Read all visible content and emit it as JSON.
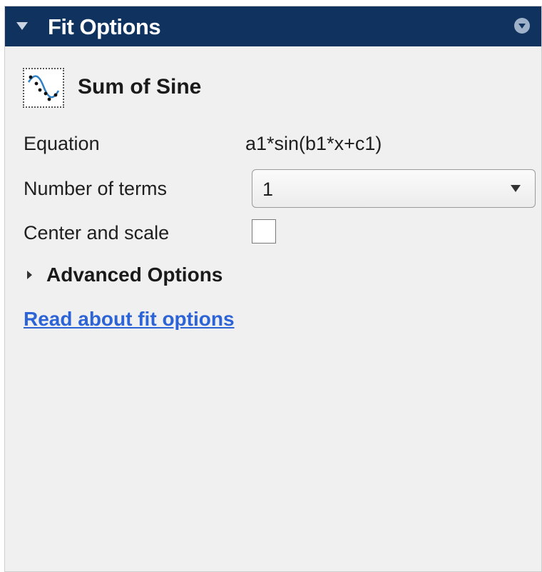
{
  "panel": {
    "title": "Fit Options"
  },
  "fit": {
    "name": "Sum of Sine",
    "icon": "sine-fit-icon"
  },
  "equation": {
    "label": "Equation",
    "value": "a1*sin(b1*x+c1)"
  },
  "terms": {
    "label": "Number of terms",
    "selected": "1"
  },
  "center_scale": {
    "label": "Center and scale",
    "checked": false
  },
  "advanced": {
    "label": "Advanced Options",
    "expanded": false
  },
  "help": {
    "link_text": "Read about fit options"
  },
  "colors": {
    "header_bg": "#10325f",
    "panel_bg": "#f0f0f0",
    "link": "#2c63d6",
    "sine_curve": "#2f80c6"
  }
}
